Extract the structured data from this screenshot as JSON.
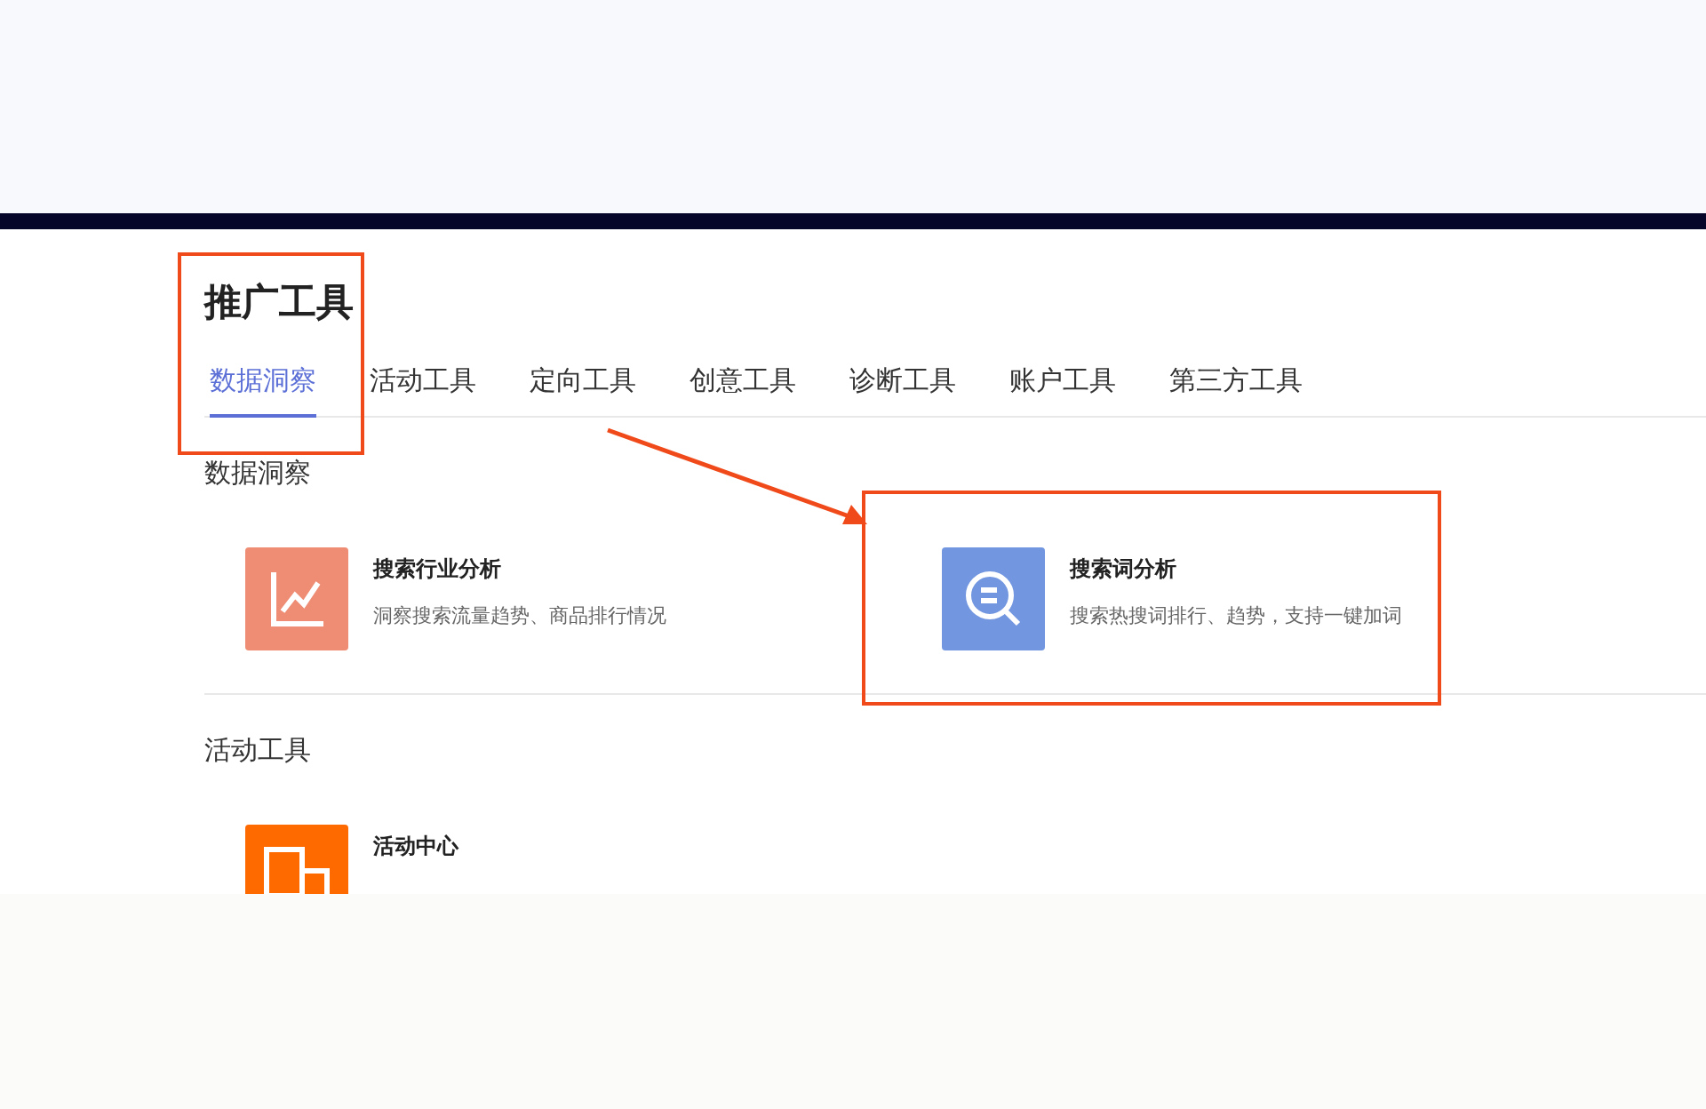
{
  "title": "推广工具",
  "tabs": [
    {
      "label": "数据洞察",
      "selected": true
    },
    {
      "label": "活动工具",
      "selected": false
    },
    {
      "label": "定向工具",
      "selected": false
    },
    {
      "label": "创意工具",
      "selected": false
    },
    {
      "label": "诊断工具",
      "selected": false
    },
    {
      "label": "账户工具",
      "selected": false
    },
    {
      "label": "第三方工具",
      "selected": false
    }
  ],
  "sections": [
    {
      "heading": "数据洞察",
      "tools": [
        {
          "kind": "chart",
          "color": "#ee8c74",
          "name": "搜索行业分析",
          "description": "洞察搜索流量趋势、商品排行情况"
        },
        {
          "kind": "search",
          "color": "#7296e0",
          "name": "搜索词分析",
          "description": "搜索热搜词排行、趋势，支持一键加词"
        }
      ]
    },
    {
      "heading": "活动工具",
      "tools": [
        {
          "kind": "boxes",
          "color": "#ff6a00",
          "name": "活动中心"
        }
      ]
    }
  ]
}
